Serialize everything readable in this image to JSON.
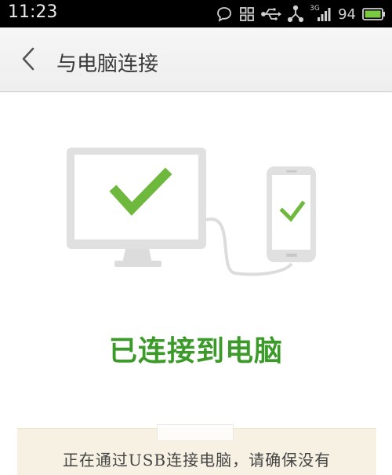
{
  "status_bar": {
    "time": "11:23",
    "network_label": "3G",
    "battery_level": "94",
    "icons": [
      "chat-bubble-icon",
      "grid-icon",
      "usb-icon",
      "usb-tether-icon",
      "signal-icon",
      "battery-icon"
    ]
  },
  "header": {
    "title": "与电脑连接",
    "back_icon": "chevron-left-icon"
  },
  "main": {
    "status_text": "已连接到电脑",
    "accent_color": "#3b9a2a"
  },
  "note": {
    "text": "正在通过USB连接电脑，请确保没有"
  }
}
